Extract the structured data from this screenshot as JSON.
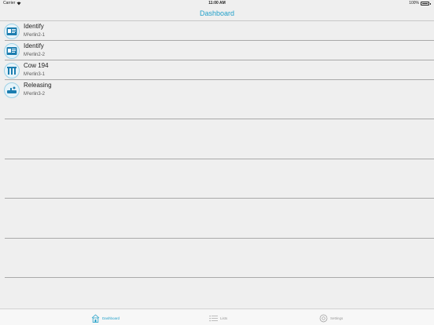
{
  "status_bar": {
    "carrier": "Carrier",
    "time": "11:00 AM",
    "battery": "100%"
  },
  "nav": {
    "title": "Dashboard"
  },
  "rows": [
    {
      "title": "Identify",
      "subtitle": "M²erlin2-1",
      "icon": "id-card-icon"
    },
    {
      "title": "Identify",
      "subtitle": "M²erlin2-2",
      "icon": "id-card-icon"
    },
    {
      "title": "Cow 194",
      "subtitle": "M²erlin3-1",
      "icon": "gate-icon"
    },
    {
      "title": "Releasing",
      "subtitle": "M²erlin3-2",
      "icon": "release-icon"
    }
  ],
  "tabs": [
    {
      "label": "Dashboard",
      "icon": "home-icon",
      "active": true
    },
    {
      "label": "Lists",
      "icon": "list-icon",
      "active": false
    },
    {
      "label": "Settings",
      "icon": "gear-icon",
      "active": false
    }
  ],
  "colors": {
    "accent": "#22a0c9",
    "background": "#efefef",
    "separator": "#a9a9a9"
  }
}
